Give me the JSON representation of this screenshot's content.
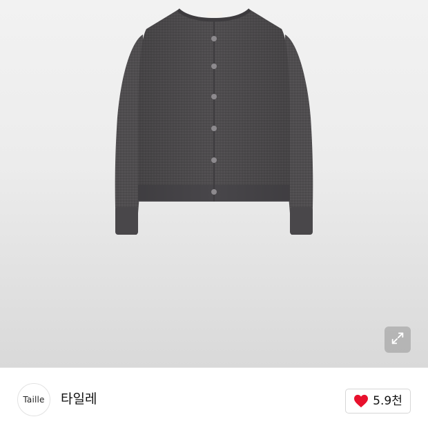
{
  "product": {
    "image_alt": "cardigan-product-image",
    "garment_color": "#4d4b4d",
    "background_color": "#ececec"
  },
  "expand": {
    "icon": "expand-icon"
  },
  "brand": {
    "logo_text": "Taille",
    "name": "타일레"
  },
  "like": {
    "icon": "heart-icon",
    "icon_color": "#e8112d",
    "count": "5.9천"
  }
}
